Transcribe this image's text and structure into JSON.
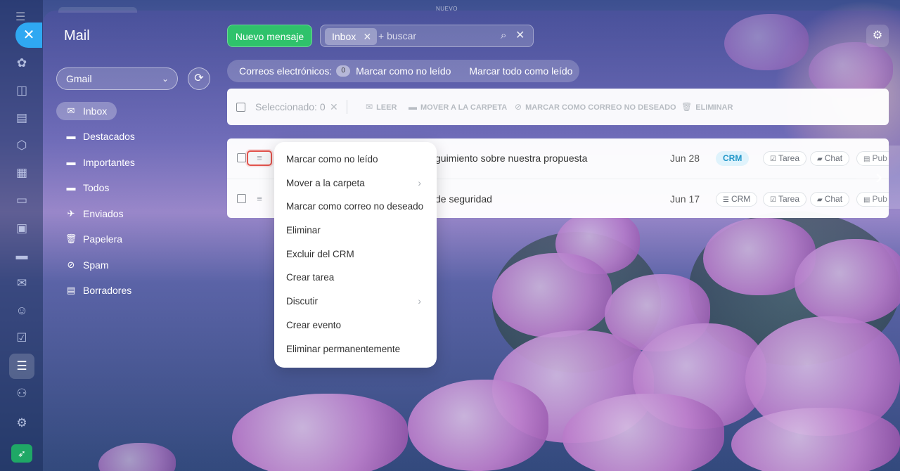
{
  "header": {
    "banner_label": "NUEVO"
  },
  "rail": {
    "items": [
      "home-icon",
      "chat-icon",
      "feed-icon",
      "hub-icon",
      "calendar-icon",
      "docs-icon",
      "sites-icon",
      "shop-icon",
      "mail-icon",
      "contacts-icon",
      "tasks-icon",
      "filter-icon",
      "robot-icon",
      "settings-icon",
      "rocket-icon"
    ]
  },
  "sidebar": {
    "title": "Mail",
    "account": "Gmail",
    "folders": [
      {
        "label": "Inbox",
        "icon": "inbox-icon",
        "active": true
      },
      {
        "label": "Destacados",
        "icon": "folder-icon"
      },
      {
        "label": "Importantes",
        "icon": "folder-icon"
      },
      {
        "label": "Todos",
        "icon": "folder-icon"
      },
      {
        "label": "Enviados",
        "icon": "sent-icon"
      },
      {
        "label": "Papelera",
        "icon": "trash-icon"
      },
      {
        "label": "Spam",
        "icon": "spam-icon"
      },
      {
        "label": "Borradores",
        "icon": "draft-icon"
      }
    ]
  },
  "topbar": {
    "new_message": "Nuevo mensaje",
    "search_chip": "Inbox",
    "search_placeholder": "+ buscar"
  },
  "infobar": {
    "label": "Correos electrónicos:",
    "count": "0",
    "mark_unread": "Marcar como no leído",
    "mark_all_read": "Marcar todo como leído"
  },
  "toolbar": {
    "selected": "Seleccionado: 0",
    "actions": [
      "LEER",
      "MOVER A LA CARPETA",
      "MARCAR COMO CORREO NO DESEADO",
      "ELIMINAR"
    ]
  },
  "list": {
    "rows": [
      {
        "subject": "guimiento sobre nuestra propuesta",
        "date": "Jun 28",
        "crm": "CRM",
        "task": "Tarea",
        "chat": "Chat",
        "pub": "Pub"
      },
      {
        "subject": "de seguridad",
        "date": "Jun 17",
        "crm": "CRM",
        "task": "Tarea",
        "chat": "Chat",
        "pub": "Pub"
      }
    ]
  },
  "context_menu": {
    "items": [
      {
        "label": "Marcar como no leído"
      },
      {
        "label": "Mover a la carpeta",
        "submenu": true
      },
      {
        "label": "Marcar como correo no deseado"
      },
      {
        "label": "Eliminar"
      },
      {
        "label": "Excluir del CRM"
      },
      {
        "label": "Crear tarea"
      },
      {
        "label": "Discutir",
        "submenu": true
      },
      {
        "label": "Crear evento"
      },
      {
        "label": "Eliminar permanentemente"
      }
    ]
  },
  "colors": {
    "accent_green": "#2fc26b",
    "close_blue": "#2fa8f2",
    "highlight_red": "#e2534c",
    "crm_blue": "#2096c8"
  }
}
